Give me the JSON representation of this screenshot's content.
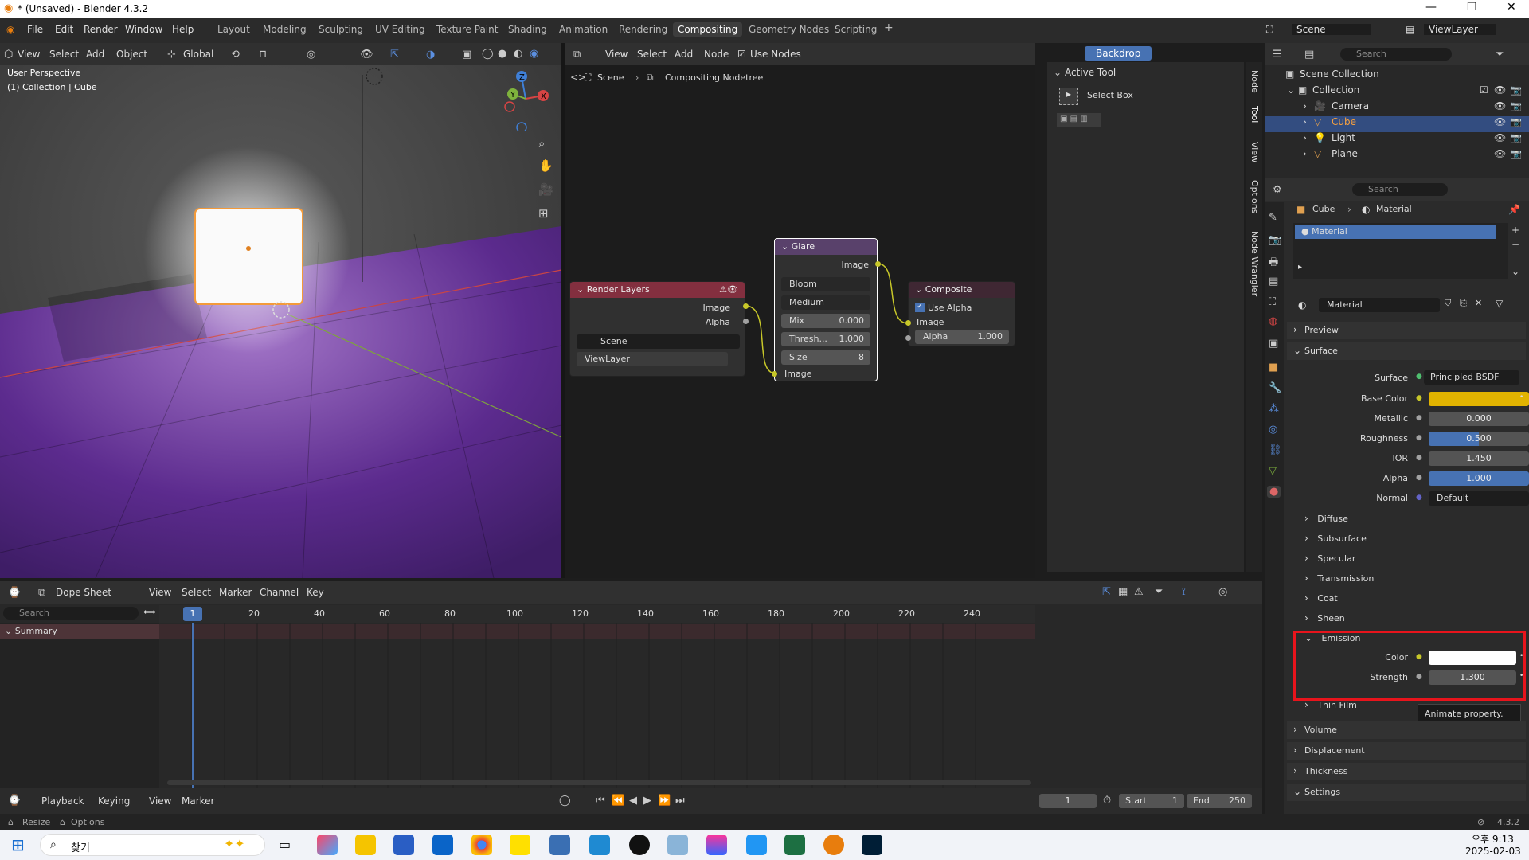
{
  "window": {
    "title": "* (Unsaved) - Blender 4.3.2"
  },
  "menu": [
    "File",
    "Edit",
    "Render",
    "Window",
    "Help"
  ],
  "workspaces": [
    "Layout",
    "Modeling",
    "Sculpting",
    "UV Editing",
    "Texture Paint",
    "Shading",
    "Animation",
    "Rendering",
    "Compositing",
    "Geometry Nodes",
    "Scripting"
  ],
  "active_workspace": "Compositing",
  "scene": {
    "name": "Scene",
    "view_layer": "ViewLayer"
  },
  "viewport": {
    "menus": [
      "View",
      "Select",
      "Add",
      "Object"
    ],
    "orientation": "Global",
    "overlay_line1": "User Perspective",
    "overlay_line2": "(1) Collection | Cube"
  },
  "node_editor": {
    "menus": [
      "View",
      "Select",
      "Add",
      "Node"
    ],
    "use_nodes": "Use Nodes",
    "backdrop": "Backdrop",
    "breadcrumb_scene": "Scene",
    "breadcrumb_tree": "Compositing Nodetree",
    "side_tabs": [
      "Node",
      "Tool",
      "View",
      "Options",
      "Node Wrangler"
    ],
    "render_layers": {
      "title": "Render Layers",
      "out_image": "Image",
      "out_alpha": "Alpha",
      "scene": "Scene",
      "view_layer": "ViewLayer"
    },
    "glare": {
      "title": "Glare",
      "out_image": "Image",
      "type": "Bloom",
      "quality": "Medium",
      "mix_label": "Mix",
      "mix_value": "0.000",
      "thresh_label": "Thresh...",
      "thresh_value": "1.000",
      "size_label": "Size",
      "size_value": "8",
      "in_image": "Image"
    },
    "composite": {
      "title": "Composite",
      "use_alpha": "Use Alpha",
      "in_image": "Image",
      "alpha_label": "Alpha",
      "alpha_value": "1.000"
    }
  },
  "tool_panel": {
    "header": "Active Tool",
    "tool": "Select Box"
  },
  "outliner": {
    "search_placeholder": "Search",
    "root": "Scene Collection",
    "collection": "Collection",
    "items": [
      "Camera",
      "Cube",
      "Light",
      "Plane"
    ],
    "selected": "Cube"
  },
  "properties": {
    "search_placeholder": "Search",
    "breadcrumb_object": "Cube",
    "breadcrumb_data": "Material",
    "slot": "Material",
    "material_name": "Material",
    "sections": {
      "preview": "Preview",
      "surface": "Surface"
    },
    "surface_label": "Surface",
    "surface_value": "Principled BSDF",
    "fields": [
      {
        "label": "Base Color",
        "value": "",
        "kind": "color",
        "color": "#e1b300"
      },
      {
        "label": "Metallic",
        "value": "0.000",
        "kind": "num",
        "fill": 0
      },
      {
        "label": "Roughness",
        "value": "0.500",
        "kind": "num",
        "fill": 0.5
      },
      {
        "label": "IOR",
        "value": "1.450",
        "kind": "num",
        "fill": 0
      },
      {
        "label": "Alpha",
        "value": "1.000",
        "kind": "num",
        "fill": 1
      },
      {
        "label": "Normal",
        "value": "Default",
        "kind": "enum"
      }
    ],
    "subpanels": [
      "Diffuse",
      "Subsurface",
      "Specular",
      "Transmission",
      "Coat",
      "Sheen"
    ],
    "emission": {
      "title": "Emission",
      "color_label": "Color",
      "strength_label": "Strength",
      "strength_value": "1.300"
    },
    "after": [
      "Thin Film",
      "Volume",
      "Displacement",
      "Thickness",
      "Settings"
    ],
    "tooltip": "Animate property."
  },
  "dopesheet": {
    "mode": "Dope Sheet",
    "menus": [
      "View",
      "Select",
      "Marker",
      "Channel",
      "Key"
    ],
    "search_placeholder": "Search",
    "summary": "Summary",
    "current_frame": "1",
    "ticks": [
      "20",
      "40",
      "60",
      "80",
      "100",
      "120",
      "140",
      "160",
      "180",
      "200",
      "220",
      "240"
    ]
  },
  "timeline": {
    "menus": [
      "Playback",
      "Keying",
      "View",
      "Marker"
    ],
    "frame": "1",
    "start_label": "Start",
    "start": "1",
    "end_label": "End",
    "end": "250"
  },
  "status": {
    "resize": "Resize",
    "options": "Options",
    "version": "4.3.2"
  },
  "taskbar": {
    "search": "찾기",
    "time": "오후 9:13",
    "date": "2025-02-03"
  }
}
